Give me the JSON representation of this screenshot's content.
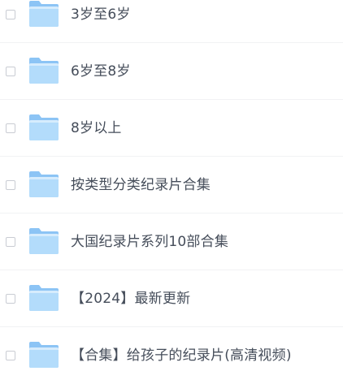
{
  "file_list": {
    "items": [
      {
        "name": "3岁至6岁",
        "type_icon": "folder-icon"
      },
      {
        "name": "6岁至8岁",
        "type_icon": "folder-icon"
      },
      {
        "name": "8岁以上",
        "type_icon": "folder-icon"
      },
      {
        "name": "按类型分类纪录片合集",
        "type_icon": "folder-icon"
      },
      {
        "name": "大国纪录片系列10部合集",
        "type_icon": "folder-icon"
      },
      {
        "name": "【2024】最新更新",
        "type_icon": "folder-icon"
      },
      {
        "name": "【合集】给孩子的纪录片(高清视频)",
        "type_icon": "folder-icon"
      }
    ]
  },
  "colors": {
    "folder_back": "#8cc4f5",
    "folder_front": "#b3dcfb",
    "text": "#454d5a",
    "divider": "#f1f2f4",
    "checkbox_border": "#c9ccd3"
  }
}
